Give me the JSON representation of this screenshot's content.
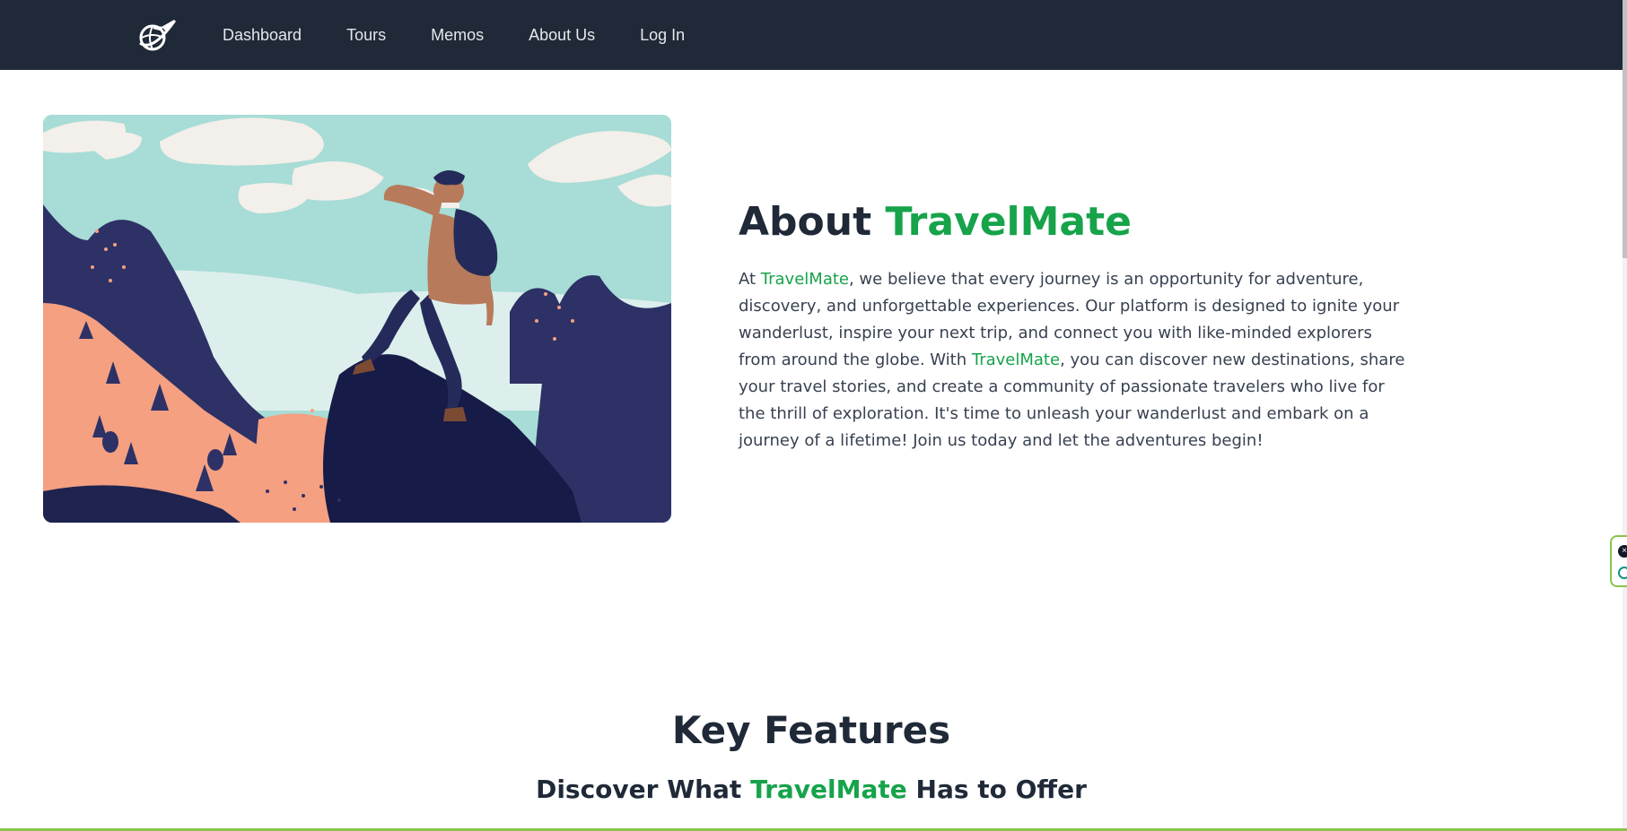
{
  "navbar": {
    "logo_icon": "airplane-globe-icon",
    "links": [
      {
        "label": "Dashboard"
      },
      {
        "label": "Tours"
      },
      {
        "label": "Memos"
      },
      {
        "label": "About Us"
      },
      {
        "label": "Log In"
      }
    ]
  },
  "about": {
    "title_prefix": "About ",
    "title_brand": "TravelMate",
    "text_part1": "At ",
    "brand": "TravelMate",
    "text_part2": ", we believe that every journey is an opportunity for adventure, discovery, and unforgettable experiences. Our platform is designed to ignite your wanderlust, inspire your next trip, and connect you with like-minded explorers from around the globe. With ",
    "text_part3": ", you can discover new destinations, share your travel stories, and create a community of passionate travelers who live for the thrill of exploration. It's time to unleash your wanderlust and embark on a journey of a lifetime! Join us today and let the adventures begin!"
  },
  "features": {
    "title": "Key Features",
    "subtitle_prefix": "Discover What ",
    "subtitle_brand": "TravelMate",
    "subtitle_suffix": " Has to Offer"
  },
  "colors": {
    "navbar_bg": "#1f2937",
    "accent": "#16a34a",
    "text": "#1f2937"
  }
}
